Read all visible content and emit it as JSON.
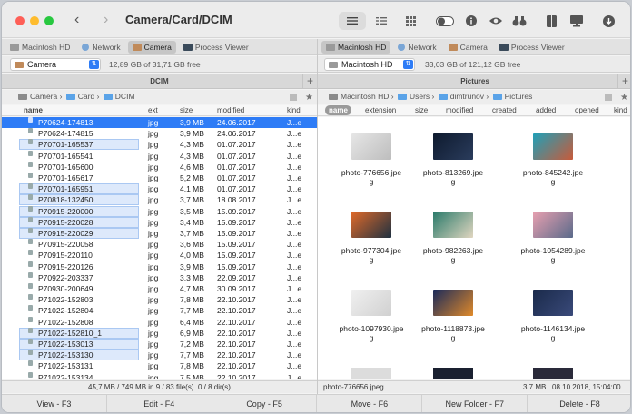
{
  "window": {
    "title": "Camera/Card/DCIM"
  },
  "icons": [
    "list-view-icon",
    "columns-view-icon",
    "grid-view-icon",
    "toggle-icon",
    "info-icon",
    "eye-icon",
    "binoculars-icon",
    "split-icon",
    "monitor-icon",
    "download-icon"
  ],
  "left": {
    "tabs": [
      "Macintosh HD",
      "Network",
      "Camera",
      "Process Viewer"
    ],
    "drive": "Camera",
    "free": "12,89 GB of 31,71 GB free",
    "pane_title": "DCIM",
    "crumbs": [
      "Camera",
      "Card",
      "DCIM"
    ],
    "headers": {
      "name": "name",
      "ext": "ext",
      "size": "size",
      "modified": "modified",
      "kind": "kind"
    },
    "rows": [
      {
        "name": "P70624-174813",
        "ext": "jpg",
        "size": "3,9 MB",
        "date": "24.06.2017",
        "kind": "J...e",
        "state": "cursor"
      },
      {
        "name": "P70624-174815",
        "ext": "jpg",
        "size": "3,9 MB",
        "date": "24.06.2017",
        "kind": "J...e",
        "state": ""
      },
      {
        "name": "P70701-165537",
        "ext": "jpg",
        "size": "4,3 MB",
        "date": "01.07.2017",
        "kind": "J...e",
        "state": "marked"
      },
      {
        "name": "P70701-165541",
        "ext": "jpg",
        "size": "4,3 MB",
        "date": "01.07.2017",
        "kind": "J...e",
        "state": ""
      },
      {
        "name": "P70701-165600",
        "ext": "jpg",
        "size": "4,6 MB",
        "date": "01.07.2017",
        "kind": "J...e",
        "state": ""
      },
      {
        "name": "P70701-165617",
        "ext": "jpg",
        "size": "5,2 MB",
        "date": "01.07.2017",
        "kind": "J...e",
        "state": ""
      },
      {
        "name": "P70701-165951",
        "ext": "jpg",
        "size": "4,1 MB",
        "date": "01.07.2017",
        "kind": "J...e",
        "state": "marked"
      },
      {
        "name": "P70818-132450",
        "ext": "jpg",
        "size": "3,7 MB",
        "date": "18.08.2017",
        "kind": "J...e",
        "state": "marked"
      },
      {
        "name": "P70915-220000",
        "ext": "jpg",
        "size": "3,5 MB",
        "date": "15.09.2017",
        "kind": "J...e",
        "state": "marked"
      },
      {
        "name": "P70915-220028",
        "ext": "jpg",
        "size": "3,4 MB",
        "date": "15.09.2017",
        "kind": "J...e",
        "state": "marked"
      },
      {
        "name": "P70915-220029",
        "ext": "jpg",
        "size": "3,7 MB",
        "date": "15.09.2017",
        "kind": "J...e",
        "state": "marked"
      },
      {
        "name": "P70915-220058",
        "ext": "jpg",
        "size": "3,6 MB",
        "date": "15.09.2017",
        "kind": "J...e",
        "state": ""
      },
      {
        "name": "P70915-220110",
        "ext": "jpg",
        "size": "4,0 MB",
        "date": "15.09.2017",
        "kind": "J...e",
        "state": ""
      },
      {
        "name": "P70915-220126",
        "ext": "jpg",
        "size": "3,9 MB",
        "date": "15.09.2017",
        "kind": "J...e",
        "state": ""
      },
      {
        "name": "P70922-203337",
        "ext": "jpg",
        "size": "3,3 MB",
        "date": "22.09.2017",
        "kind": "J...e",
        "state": ""
      },
      {
        "name": "P70930-200649",
        "ext": "jpg",
        "size": "4,7 MB",
        "date": "30.09.2017",
        "kind": "J...e",
        "state": ""
      },
      {
        "name": "P71022-152803",
        "ext": "jpg",
        "size": "7,8 MB",
        "date": "22.10.2017",
        "kind": "J...e",
        "state": ""
      },
      {
        "name": "P71022-152804",
        "ext": "jpg",
        "size": "7,7 MB",
        "date": "22.10.2017",
        "kind": "J...e",
        "state": ""
      },
      {
        "name": "P71022-152808",
        "ext": "jpg",
        "size": "6,4 MB",
        "date": "22.10.2017",
        "kind": "J...e",
        "state": ""
      },
      {
        "name": "P71022-152810_1",
        "ext": "jpg",
        "size": "6,9 MB",
        "date": "22.10.2017",
        "kind": "J...e",
        "state": "marked"
      },
      {
        "name": "P71022-153013",
        "ext": "jpg",
        "size": "7,2 MB",
        "date": "22.10.2017",
        "kind": "J...e",
        "state": "marked"
      },
      {
        "name": "P71022-153130",
        "ext": "jpg",
        "size": "7,7 MB",
        "date": "22.10.2017",
        "kind": "J...e",
        "state": "marked"
      },
      {
        "name": "P71022-153131",
        "ext": "jpg",
        "size": "7,8 MB",
        "date": "22.10.2017",
        "kind": "J...e",
        "state": ""
      },
      {
        "name": "P71022-153134",
        "ext": "jpg",
        "size": "7,5 MB",
        "date": "22.10.2017",
        "kind": "J...e",
        "state": ""
      }
    ],
    "status": "45,7 MB / 749 MB in 9 / 83 file(s). 0 / 8 dir(s)"
  },
  "right": {
    "tabs": [
      "Macintosh HD",
      "Network",
      "Camera",
      "Process Viewer"
    ],
    "drive": "Macintosh HD",
    "free": "33,03 GB of 121,12 GB free",
    "pane_title": "Pictures",
    "crumbs": [
      "Macintosh HD",
      "Users",
      "dimtrunov",
      "Pictures"
    ],
    "headers": {
      "name": "name",
      "extension": "extension",
      "size": "size",
      "modified": "modified",
      "created": "created",
      "added": "added",
      "opened": "opened",
      "kind": "kind"
    },
    "thumbs": [
      {
        "line1": "photo-776656.jpe",
        "line2": "g",
        "color1": "#e6e6e6",
        "color2": "#bdbdbd"
      },
      {
        "line1": "photo-813269.jpe",
        "line2": "g",
        "color1": "#0e1a2e",
        "color2": "#2a3c5c"
      },
      {
        "line1": "photo-845242.jpe",
        "line2": "g",
        "color1": "#1fa0b8",
        "color2": "#c85a3a"
      },
      {
        "line1": "photo-977304.jpe",
        "line2": "g",
        "color1": "#e06a2a",
        "color2": "#1e3040"
      },
      {
        "line1": "photo-982263.jpe",
        "line2": "g",
        "color1": "#2a7a6a",
        "color2": "#e0d6c0"
      },
      {
        "line1": "photo-1054289.jpe",
        "line2": "g",
        "color1": "#e8a0b0",
        "color2": "#5a6a8a"
      },
      {
        "line1": "photo-1097930.jpe",
        "line2": "g",
        "color1": "#f0f0f0",
        "color2": "#d0d0d0"
      },
      {
        "line1": "photo-1118873.jpe",
        "line2": "g",
        "color1": "#1a2a5a",
        "color2": "#e08a2a"
      },
      {
        "line1": "photo-1146134.jpe",
        "line2": "g",
        "color1": "#1a2a4a",
        "color2": "#3a4a7a"
      }
    ],
    "status_name": "photo-776656.jpeg",
    "status_size": "3,7 MB",
    "status_date": "08.10.2018, 15:04:00"
  },
  "fn": [
    "View - F3",
    "Edit - F4",
    "Copy - F5",
    "Move - F6",
    "New Folder - F7",
    "Delete - F8"
  ]
}
